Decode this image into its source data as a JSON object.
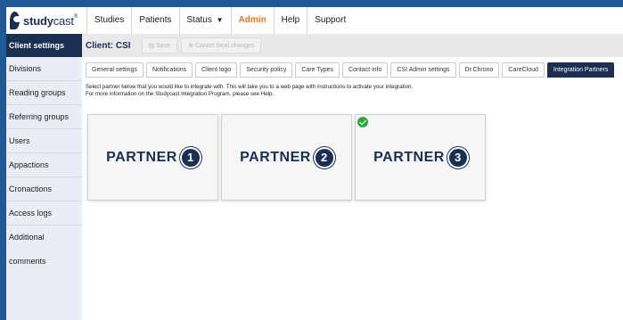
{
  "logo": {
    "brand_bold": "study",
    "brand_light": "cast",
    "reg": "®"
  },
  "nav": {
    "items": [
      {
        "label": "Studies"
      },
      {
        "label": "Patients"
      },
      {
        "label": "Status"
      },
      {
        "label": "Admin"
      },
      {
        "label": "Help"
      },
      {
        "label": "Support"
      }
    ],
    "status_caret": "▼"
  },
  "sidebar": {
    "header": "Client settings",
    "items": [
      {
        "label": "Divisions"
      },
      {
        "label": "Reading groups"
      },
      {
        "label": "Referring groups"
      },
      {
        "label": "Users"
      },
      {
        "label": "Appactions"
      },
      {
        "label": "Cronactions"
      },
      {
        "label": "Access logs"
      },
      {
        "label": "Additional comments"
      }
    ]
  },
  "toolbar": {
    "client_title": "Client: CSI",
    "save_label": "Save",
    "cancel_label": "Cancel local changes"
  },
  "tabs": [
    {
      "label": "General settings"
    },
    {
      "label": "Notifications"
    },
    {
      "label": "Client logo"
    },
    {
      "label": "Security policy"
    },
    {
      "label": "Care Types"
    },
    {
      "label": "Contact info"
    },
    {
      "label": "CSI Admin settings"
    },
    {
      "label": "Dr.Chrono"
    },
    {
      "label": "CareCloud"
    },
    {
      "label": "Integration Partners",
      "active": true
    }
  ],
  "intro": {
    "line1": "Select partner below that you would like to integrate with. This will take you to a web page with instructions to activate your integration.",
    "line2": "For more information on the Studycast Integration Program, please see Help."
  },
  "partners": [
    {
      "label": "PARTNER",
      "number": "1",
      "selected": false
    },
    {
      "label": "PARTNER",
      "number": "2",
      "selected": false
    },
    {
      "label": "PARTNER",
      "number": "3",
      "selected": true
    }
  ],
  "colors": {
    "navy": "#1b2f52",
    "accent": "#e8761a",
    "check": "#2ea83f",
    "frame": "#1f5a96"
  }
}
